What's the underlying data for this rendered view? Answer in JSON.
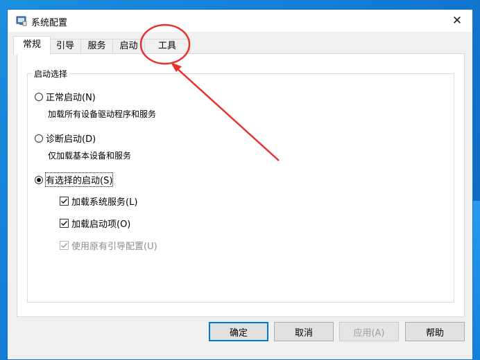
{
  "window": {
    "title": "系统配置",
    "close_glyph": "✕"
  },
  "tabs": [
    {
      "label": "常规",
      "active": true
    },
    {
      "label": "引导",
      "active": false
    },
    {
      "label": "服务",
      "active": false
    },
    {
      "label": "启动",
      "active": false
    },
    {
      "label": "工具",
      "active": false
    }
  ],
  "startup_selection": {
    "legend": "启动选择",
    "options": [
      {
        "label": "正常启动(N)",
        "description": "加载所有设备驱动程序和服务",
        "selected": false
      },
      {
        "label": "诊断启动(D)",
        "description": "仅加载基本设备和服务",
        "selected": false
      },
      {
        "label": "有选择的启动(S)",
        "selected": true
      }
    ],
    "checkboxes": [
      {
        "label": "加载系统服务(L)",
        "checked": true,
        "enabled": true
      },
      {
        "label": "加载启动项(O)",
        "checked": true,
        "enabled": true
      },
      {
        "label": "使用原有引导配置(U)",
        "checked": true,
        "enabled": false
      }
    ]
  },
  "buttons": {
    "ok": "确定",
    "cancel": "取消",
    "apply": "应用(A)",
    "help": "帮助"
  },
  "colors": {
    "desktop": "#1176cf",
    "annotation": "#e8322a",
    "default_button_border": "#0078d7"
  }
}
